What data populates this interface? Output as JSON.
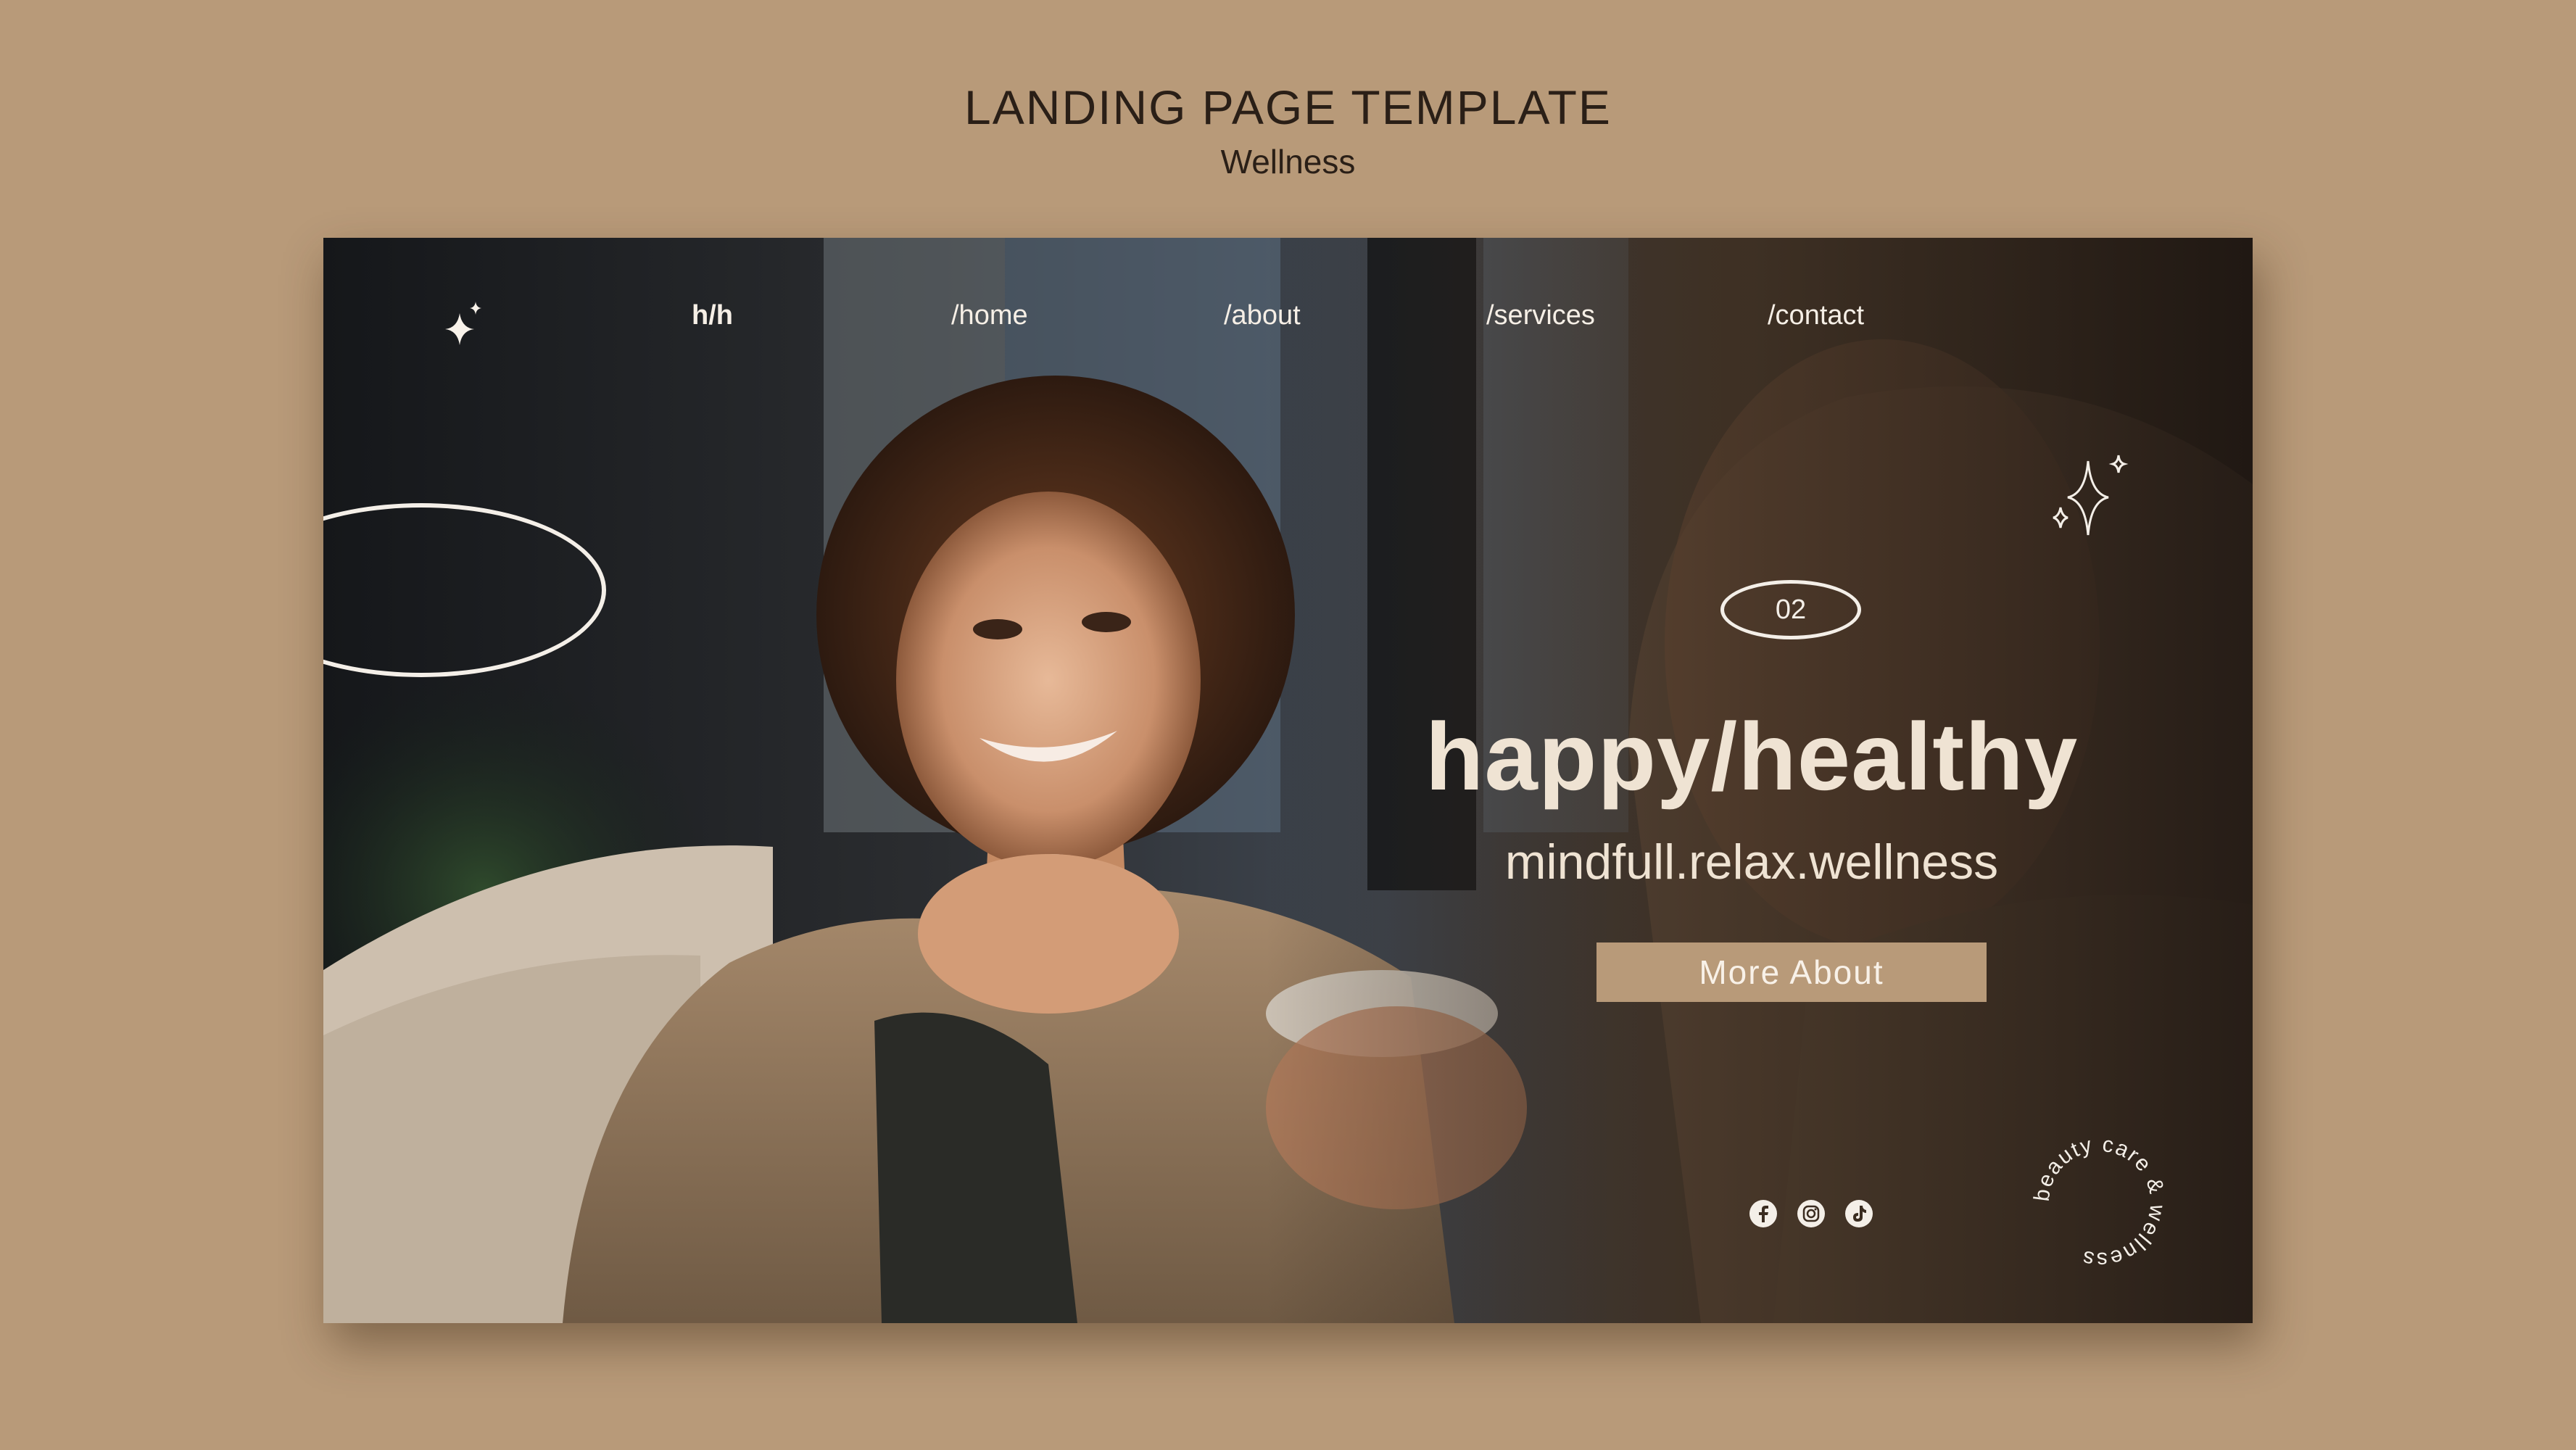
{
  "header": {
    "title": "LANDING PAGE TEMPLATE",
    "subtitle": "Wellness"
  },
  "nav": {
    "logo": "h/h",
    "items": [
      "/home",
      "/about",
      "/services",
      "/contact"
    ]
  },
  "hero": {
    "badge": "02",
    "headline": "happy/healthy",
    "tagline": "mindfull.relax.wellness",
    "cta_label": "More About",
    "circular_text": "beauty care & wellness"
  },
  "social": [
    "facebook-icon",
    "instagram-icon",
    "tiktok-icon"
  ],
  "colors": {
    "background": "#b89a79",
    "text_dark": "#2a1f17",
    "text_light": "#efe3d3",
    "button": "#b89a79"
  }
}
